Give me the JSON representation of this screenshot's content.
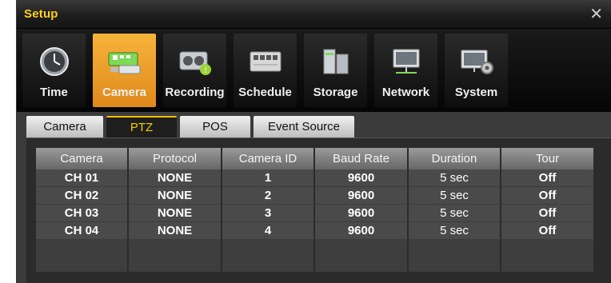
{
  "window": {
    "title": "Setup",
    "close_glyph": "✕"
  },
  "menu": [
    {
      "label": "Time",
      "icon": "clock-icon"
    },
    {
      "label": "Camera",
      "icon": "camera-icon",
      "active": true
    },
    {
      "label": "Recording",
      "icon": "recording-icon"
    },
    {
      "label": "Schedule",
      "icon": "schedule-icon"
    },
    {
      "label": "Storage",
      "icon": "storage-icon"
    },
    {
      "label": "Network",
      "icon": "network-icon"
    },
    {
      "label": "System",
      "icon": "system-icon"
    }
  ],
  "tabs": [
    {
      "label": "Camera"
    },
    {
      "label": "PTZ",
      "active": true
    },
    {
      "label": "POS"
    },
    {
      "label": "Event Source"
    }
  ],
  "table": {
    "headers": [
      "Camera",
      "Protocol",
      "Camera ID",
      "Baud Rate",
      "Duration",
      "Tour"
    ],
    "rows": [
      [
        "CH 01",
        "NONE",
        "1",
        "9600",
        "5 sec",
        "Off"
      ],
      [
        "CH 02",
        "NONE",
        "2",
        "9600",
        "5 sec",
        "Off"
      ],
      [
        "CH 03",
        "NONE",
        "3",
        "9600",
        "5 sec",
        "Off"
      ],
      [
        "CH 04",
        "NONE",
        "4",
        "9600",
        "5 sec",
        "Off"
      ]
    ]
  },
  "colors": {
    "accent": "#f2c200",
    "title_text": "#ffd21a",
    "active_menu": "#ee9c26"
  }
}
